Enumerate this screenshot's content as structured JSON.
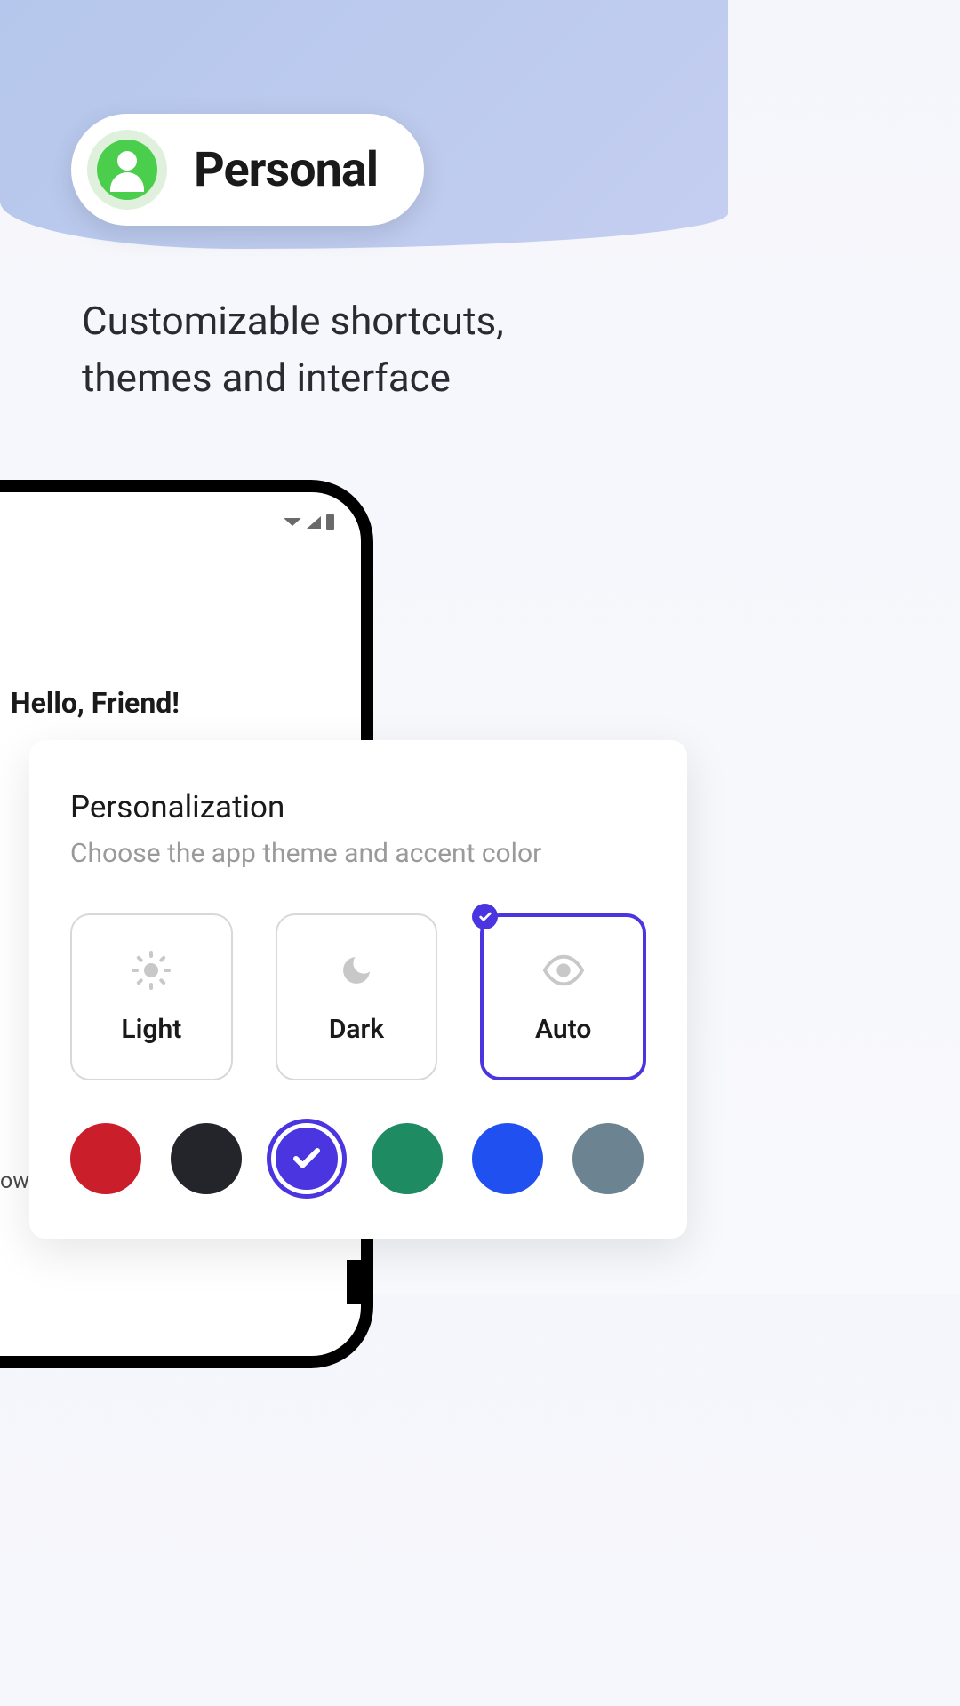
{
  "header": {
    "pill_label": "Personal",
    "tagline": "Customizable shortcuts,\nthemes and interface"
  },
  "greeting": "Hello, Friend!",
  "personalization": {
    "title": "Personalization",
    "subtitle": "Choose the app theme and accent color",
    "themes": [
      {
        "label": "Light",
        "selected": false
      },
      {
        "label": "Dark",
        "selected": false
      },
      {
        "label": "Auto",
        "selected": true
      }
    ],
    "colors": [
      {
        "name": "red",
        "hex": "#ca1e2b",
        "selected": false
      },
      {
        "name": "black",
        "hex": "#23252a",
        "selected": false
      },
      {
        "name": "purple",
        "hex": "#4a35e0",
        "selected": true
      },
      {
        "name": "green",
        "hex": "#1f8b63",
        "selected": false
      },
      {
        "name": "blue",
        "hex": "#2050f0",
        "selected": false
      },
      {
        "name": "grey",
        "hex": "#6c8492",
        "selected": false
      }
    ]
  },
  "fragment_text": "ows",
  "accent_color": "#4a35e0"
}
